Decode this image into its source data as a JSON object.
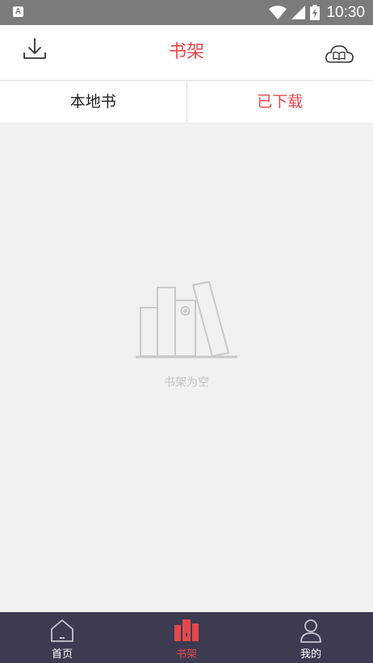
{
  "status_bar": {
    "time": "10:30",
    "icons": [
      "notification-a-icon",
      "wifi-icon",
      "cell-signal-icon",
      "battery-charging-icon"
    ]
  },
  "header": {
    "title": "书架",
    "left_icon": "download-icon",
    "right_icon": "cloud-book-icon"
  },
  "tabs": [
    {
      "label": "本地书",
      "active": false
    },
    {
      "label": "已下载",
      "active": true
    }
  ],
  "empty_state": {
    "icon": "empty-bookshelf-icon",
    "text": "书架为空"
  },
  "bottom_nav": [
    {
      "label": "首页",
      "icon": "home-icon",
      "active": false
    },
    {
      "label": "书架",
      "icon": "bookshelf-icon",
      "active": true
    },
    {
      "label": "我的",
      "icon": "user-icon",
      "active": false
    }
  ],
  "colors": {
    "accent": "#e5484d",
    "nav_background": "#3d3b51",
    "page_background": "#f1f1f1",
    "status_bar": "#7b7b7b"
  }
}
